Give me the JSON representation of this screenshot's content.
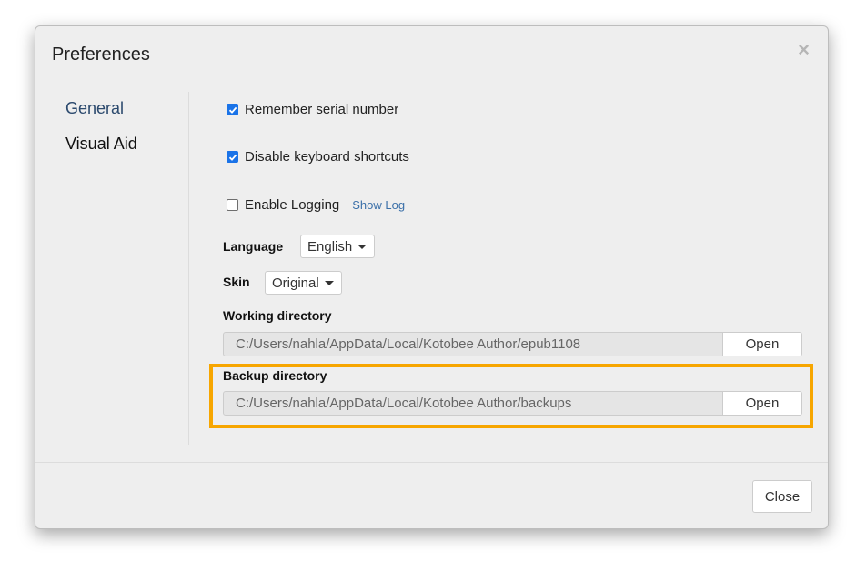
{
  "dialog": {
    "title": "Preferences",
    "close_icon": "×"
  },
  "sidebar": {
    "items": [
      {
        "label": "General",
        "active": true
      },
      {
        "label": "Visual Aid",
        "active": false
      }
    ]
  },
  "settings": {
    "remember_serial": {
      "label": "Remember serial number",
      "checked": true
    },
    "disable_shortcuts": {
      "label": "Disable keyboard shortcuts",
      "checked": true
    },
    "enable_logging": {
      "label": "Enable Logging",
      "checked": false,
      "link": "Show Log"
    },
    "language": {
      "label": "Language",
      "value": "English"
    },
    "skin": {
      "label": "Skin",
      "value": "Original"
    },
    "working_directory": {
      "label": "Working directory",
      "path": "C:/Users/nahla/AppData/Local/Kotobee Author/epub1108",
      "button": "Open"
    },
    "backup_directory": {
      "label": "Backup directory",
      "path": "C:/Users/nahla/AppData/Local/Kotobee Author/backups",
      "button": "Open"
    }
  },
  "footer": {
    "close_label": "Close"
  },
  "colors": {
    "accent": "#1a73e8",
    "highlight": "#f7a600",
    "link": "#3a6fa8",
    "active_nav": "#2c4a6e"
  }
}
